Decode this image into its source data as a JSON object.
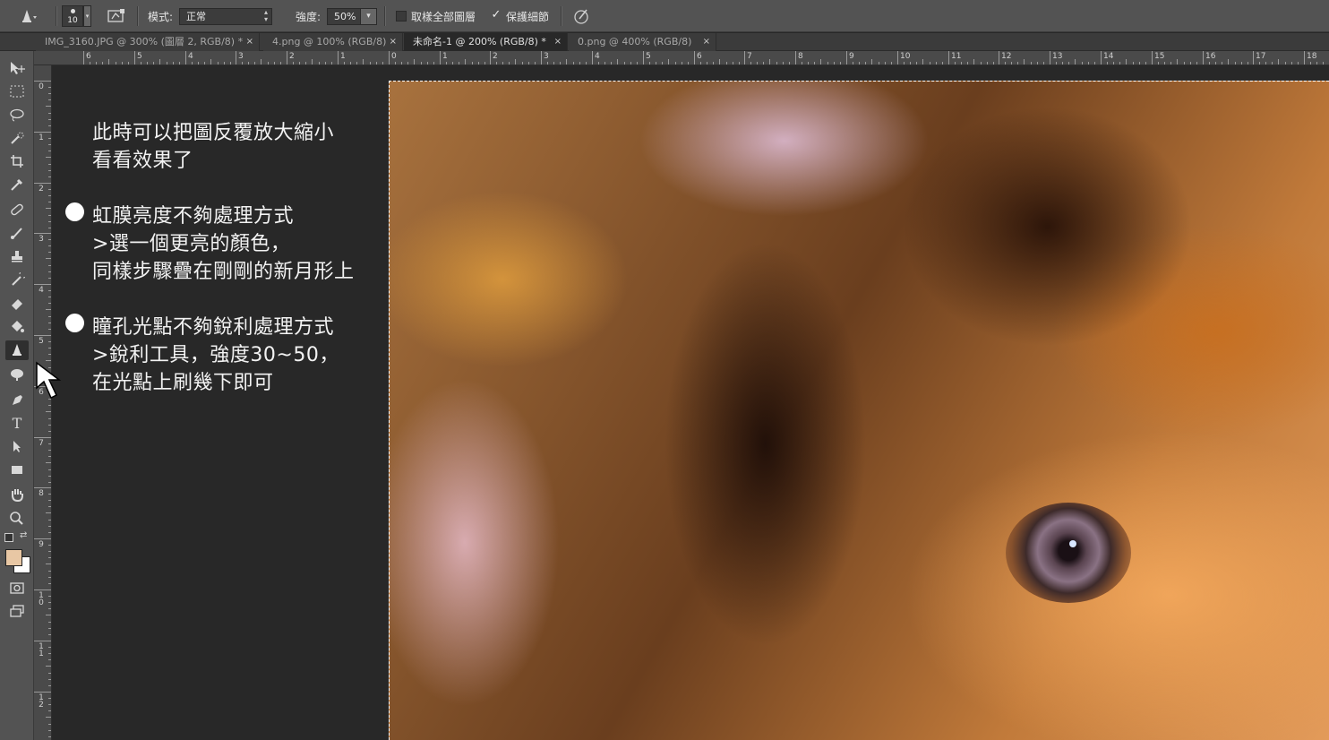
{
  "options_bar": {
    "brush_size": "10",
    "mode_label": "模式:",
    "mode_value": "正常",
    "strength_label": "強度:",
    "strength_value": "50%",
    "sample_all_label": "取樣全部圖層",
    "sample_all_checked": false,
    "protect_detail_label": "保護細節",
    "protect_detail_checked": true
  },
  "tabs": [
    {
      "label": "IMG_3160.JPG @ 300% (圖層 2, RGB/8) *",
      "active": false
    },
    {
      "label": "4.png @ 100% (RGB/8)",
      "active": false
    },
    {
      "label": "未命名-1 @ 200% (RGB/8) *",
      "active": true
    },
    {
      "label": "0.png @ 400% (RGB/8)",
      "active": false
    }
  ],
  "tab_close_glyph": "×",
  "rulers": {
    "horizontal": [
      "6",
      "5",
      "4",
      "3",
      "2",
      "1",
      "0",
      "1",
      "2",
      "3",
      "4",
      "5",
      "6",
      "7",
      "8",
      "9",
      "10",
      "11",
      "12",
      "13",
      "14",
      "15",
      "16",
      "17",
      "18"
    ],
    "vertical": [
      "0",
      "1",
      "2",
      "3",
      "4",
      "5",
      "6",
      "7",
      "8",
      "9",
      "10",
      "11",
      "12"
    ]
  },
  "toolbar": {
    "tools": [
      "move-tool",
      "marquee-tool",
      "lasso-tool",
      "quick-selection-tool",
      "crop-tool",
      "eyedropper-tool",
      "healing-brush-tool",
      "brush-tool",
      "clone-stamp-tool",
      "history-brush-tool",
      "eraser-tool",
      "paint-bucket-tool",
      "sharpen-tool",
      "burn-tool",
      "pen-tool",
      "type-tool",
      "path-selection-tool",
      "rectangle-tool",
      "hand-tool",
      "zoom-tool"
    ],
    "selected": "sharpen-tool",
    "foreground_color": "#e8c7a4",
    "background_color": "#ffffff"
  },
  "notes": {
    "intro_line1": "此時可以把圖反覆放大縮小",
    "intro_line2": "看看效果了",
    "item1_line1": "虹膜亮度不夠處理方式",
    "item1_line2": ">選一個更亮的顏色，",
    "item1_line3": "同樣步驟疊在剛剛的新月形上",
    "item2_line1": "瞳孔光點不夠銳利處理方式",
    "item2_line2": ">銳利工具，強度30~50，",
    "item2_line3": "在光點上刷幾下即可"
  },
  "colors": {
    "panel": "#535353",
    "canvas_bg": "#282828",
    "note_text": "#f2f2f2"
  }
}
